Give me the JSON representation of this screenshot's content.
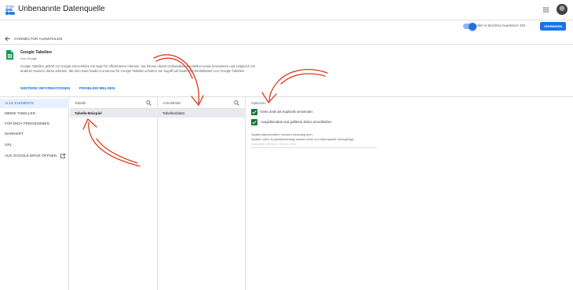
{
  "app": {
    "title": "Unbenannte Datenquelle"
  },
  "header": {
    "toggle_label": "Felder in Berichten bearbeiten: EIN",
    "connect_button": "VERBINDEN"
  },
  "back": {
    "label": "CONNECTOR AUSWÄHLEN"
  },
  "connector": {
    "title": "Google Tabellen",
    "by": "Von Google",
    "description": "Google Tabellen gehört zur Google Docs-Reihe mit Apps für effizienteres Arbeiten. Sie können damit Onlinetabellen erstellen sowie formatieren und zeitgleich mit anderen Nutzern daran arbeiten. Mit dem Data Studio-Connector für Google Tabellen erhalten Sie Zugriff auf Daten in Arbeitsblättern von Google Tabellen.",
    "link_more": "WEITERE INFORMATIONEN",
    "link_report": "PROBLEM MELDEN"
  },
  "nav": {
    "items": [
      {
        "label": "ALLE ELEMENTE",
        "active": true
      },
      {
        "label": "MEINE TABELLEN"
      },
      {
        "label": "FÜR MICH FREIGEGEBEN"
      },
      {
        "label": "MARKIERT"
      },
      {
        "label": "URL"
      },
      {
        "label": "AUS GOOGLE DRIVE ÖFFNEN"
      }
    ]
  },
  "table_col": {
    "header": "Tabelle",
    "selected": "Tabelle-Beispiel"
  },
  "sheet_col": {
    "header": "Arbeitsblatt",
    "selected": "Tabellenblatt1"
  },
  "options": {
    "header": "Optionen",
    "checks": [
      {
        "label": "Erste Zeile als Kopfzeile verwenden",
        "checked": true
      },
      {
        "label": "Ausgeblendete und gefilterte Zeilen einschließen",
        "checked": true
      }
    ],
    "hint_line1": "Spaltenüberschriften müssen eindeutig sein.",
    "hint_line2": "Spalten ohne Kopfzeileneintrag werden nicht zur Datenquelle hinzugefügt.",
    "range_placeholder": "Optionaler Bereich, etwa A1:B52"
  },
  "colors": {
    "accent": "#1a73e8",
    "selected_bg": "#e8f0fe",
    "checkbox": "#137333",
    "annotation": "#d93b1c"
  },
  "icons": [
    "datastudio-logo",
    "apps-grid-icon",
    "avatar",
    "back-arrow-icon",
    "sheets-icon",
    "search-icon",
    "open-external-icon",
    "check-icon"
  ]
}
